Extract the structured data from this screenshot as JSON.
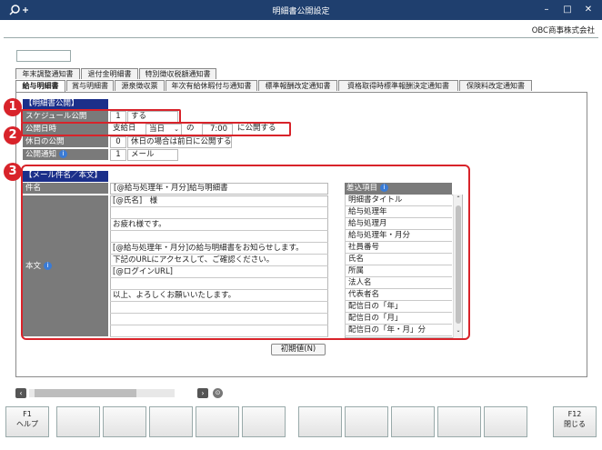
{
  "window": {
    "title": "明細書公開設定",
    "company": "OBC商事株式会社"
  },
  "tabs_row1": [
    "年末調整通知書",
    "退付金明細書",
    "特別徴収税額通知書"
  ],
  "tabs_row2": [
    "給与明細書",
    "賞与明細書",
    "源泉徴収票",
    "年次有給休暇付与通知書",
    "標準報酬改定通知書",
    "資格取得時標準報酬決定通知書",
    "保険料改定通知書"
  ],
  "publish": {
    "header": "【明細書公開】",
    "schedule_label": "スケジュール公開",
    "schedule_code": "1",
    "schedule_value": "する",
    "datetime_label": "公開日時",
    "datetime_base": "支給日",
    "datetime_day": "当日",
    "datetime_no": "の",
    "datetime_time": "7:00",
    "datetime_suffix": "に公開する",
    "holiday_label": "休日の公開",
    "holiday_code": "0",
    "holiday_value": "休日の場合は前日に公開する",
    "notify_label": "公開通知",
    "notify_code": "1",
    "notify_value": "メール"
  },
  "mail": {
    "header": "【メール件名／本文】",
    "subject_label": "件名",
    "subject_value": "[@給与処理年・月分]給与明細書",
    "body_label": "本文",
    "body_lines": [
      "[@氏名]　様",
      "",
      "お疲れ様です。",
      "",
      "[@給与処理年・月分]の給与明細書をお知らせします。",
      "下記のURLにアクセスして、ご確認ください。",
      "[@ログインURL]",
      "",
      "以上、よろしくお願いいたします。",
      "",
      "",
      ""
    ],
    "insert_header": "差込項目",
    "insert_items": [
      "明細書タイトル",
      "給与処理年",
      "給与処理月",
      "給与処理年・月分",
      "社員番号",
      "氏名",
      "所属",
      "法人名",
      "代表者名",
      "配信日の「年」",
      "配信日の「月」",
      "配信日の「年・月」分"
    ]
  },
  "default_button": "初期値(N)",
  "badges": [
    "1",
    "2",
    "3"
  ],
  "fkeys": [
    {
      "key": "F1",
      "label": "ヘルプ"
    },
    {
      "key": "",
      "label": ""
    },
    {
      "key": "",
      "label": ""
    },
    {
      "key": "",
      "label": ""
    },
    {
      "key": "",
      "label": ""
    },
    {
      "key": "",
      "label": ""
    },
    {
      "key": "",
      "label": ""
    },
    {
      "key": "",
      "label": ""
    },
    {
      "key": "",
      "label": ""
    },
    {
      "key": "",
      "label": ""
    },
    {
      "key": "",
      "label": ""
    },
    {
      "key": "F12",
      "label": "閉じる"
    }
  ],
  "colors": {
    "titlebar": "#1f3f6e",
    "section_header": "#1b2f8a",
    "highlight": "#d8232a"
  }
}
